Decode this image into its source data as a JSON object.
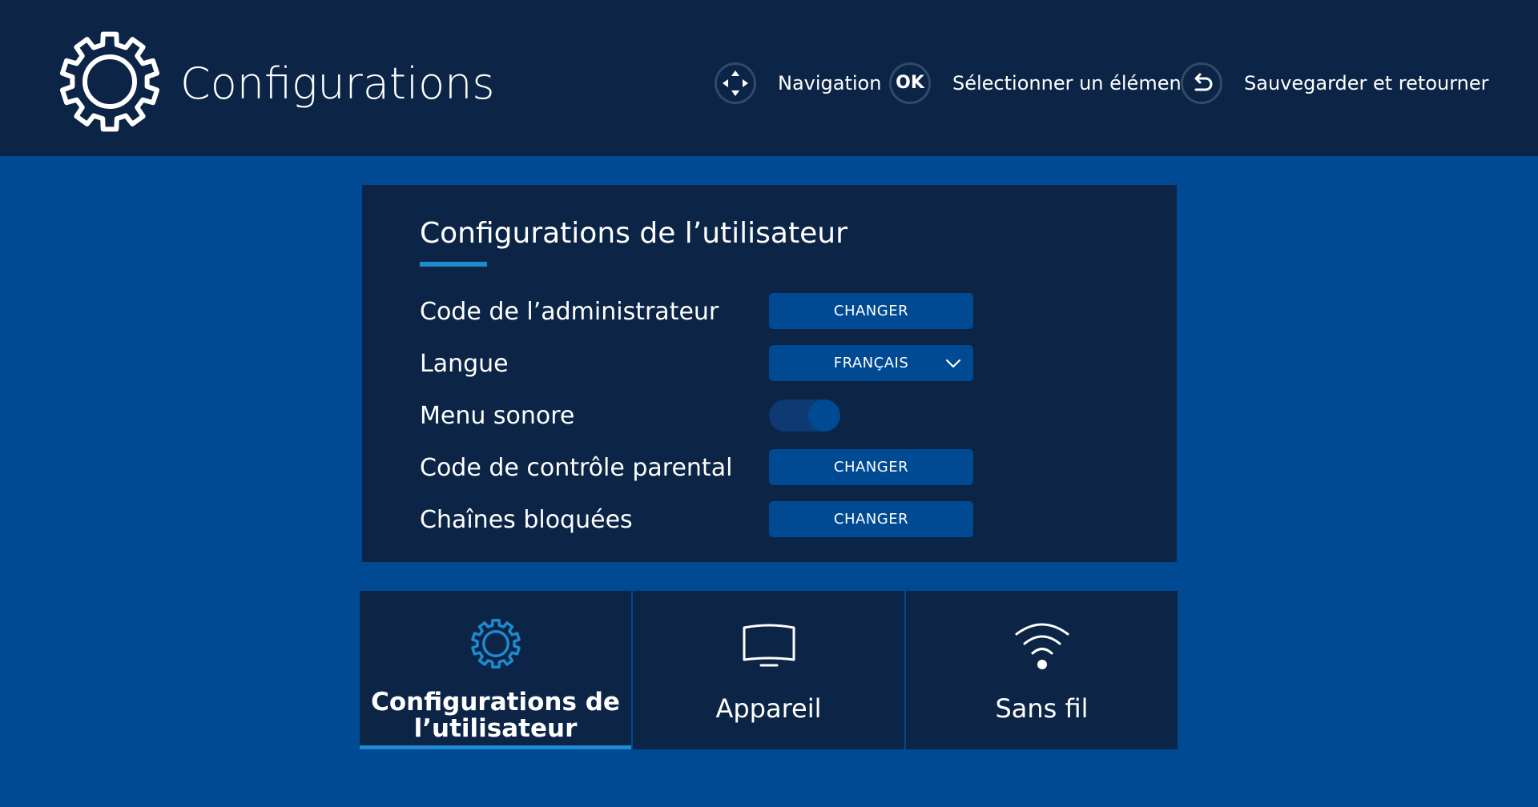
{
  "header": {
    "title": "Configurations",
    "hints": [
      {
        "icon": "dpad-icon",
        "label": "Navigation"
      },
      {
        "icon": "ok-icon",
        "text": "OK",
        "label": "Sélectionner un élément"
      },
      {
        "icon": "back-icon",
        "label": "Sauvegarder et retourner"
      }
    ]
  },
  "panel": {
    "title": "Configurations de l’utilisateur",
    "rows": [
      {
        "label": "Code de l’administrateur",
        "control": "button",
        "value": "CHANGER"
      },
      {
        "label": "Langue",
        "control": "select",
        "value": "FRANÇAIS"
      },
      {
        "label": "Menu sonore",
        "control": "toggle",
        "value": "on"
      },
      {
        "label": "Code de contrôle parental",
        "control": "button",
        "value": "CHANGER"
      },
      {
        "label": "Chaînes bloquées",
        "control": "button",
        "value": "CHANGER"
      }
    ]
  },
  "tabs": [
    {
      "icon": "gear-icon",
      "line1": "Configurations de",
      "line2": "l’utilisateur",
      "active": true
    },
    {
      "icon": "tv-icon",
      "label": "Appareil",
      "active": false
    },
    {
      "icon": "wifi-icon",
      "label": "Sans fil",
      "active": false
    }
  ],
  "colors": {
    "background": "#004a93",
    "panel": "#0c2546",
    "accent": "#1d8ad2",
    "button": "#004a93"
  }
}
